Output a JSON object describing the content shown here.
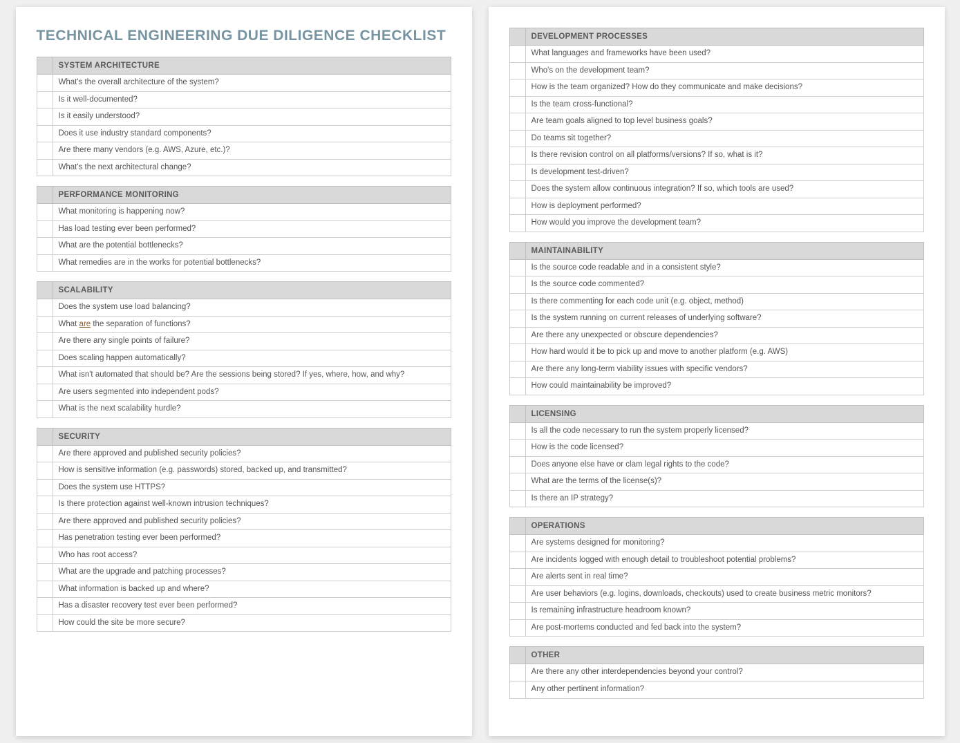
{
  "title": "TECHNICAL ENGINEERING DUE DILIGENCE CHECKLIST",
  "left_sections": [
    {
      "heading": "SYSTEM ARCHITECTURE",
      "items": [
        "What's the overall architecture of the system?",
        "Is it well-documented?",
        "Is it easily understood?",
        "Does it use industry standard components?",
        "Are there many vendors (e.g. AWS, Azure, etc.)?",
        "What's the next architectural change?"
      ]
    },
    {
      "heading": "PERFORMANCE MONITORING",
      "items": [
        "What monitoring is happening now?",
        "Has load testing ever been performed?",
        "What are the potential bottlenecks?",
        "What remedies are in the works for potential bottlenecks?"
      ]
    },
    {
      "heading": "SCALABILITY",
      "items": [
        "Does the system use load balancing?",
        "What <u>are</u> the separation of functions?",
        "Are there any single points of failure?",
        "Does scaling happen automatically?",
        "What isn't automated that should be? Are the sessions being stored? If yes, where, how, and why?",
        "Are users segmented into independent pods?",
        "What is the next scalability hurdle?"
      ]
    },
    {
      "heading": "SECURITY",
      "items": [
        "Are there approved and published security policies?",
        "How is sensitive information (e.g. passwords) stored, backed up, and transmitted?",
        "Does the system use HTTPS?",
        "Is there protection against well-known intrusion techniques?",
        "Are there approved and published security policies?",
        "Has penetration testing ever been performed?",
        "Who has root access?",
        "What are the upgrade and patching processes?",
        "What information is backed up and where?",
        "Has a disaster recovery test ever been performed?",
        "How could the site be more secure?"
      ]
    }
  ],
  "right_sections": [
    {
      "heading": "DEVELOPMENT PROCESSES",
      "items": [
        "What languages and frameworks have been used?",
        "Who's on the development team?",
        "How is the team organized? How do they communicate and make decisions?",
        "Is the team cross-functional?",
        "Are team goals aligned to top level business goals?",
        "Do teams sit together?",
        "Is there revision control on all platforms/versions? If so, what is it?",
        "Is development test-driven?",
        "Does the system allow continuous integration? If so, which tools are used?",
        "How is deployment performed?",
        "How would you improve the development team?"
      ]
    },
    {
      "heading": "MAINTAINABILITY",
      "items": [
        "Is the source code readable and in a consistent style?",
        "Is the source code commented?",
        "Is there commenting for each code unit (e.g. object, method)",
        "Is the system running on current releases of underlying software?",
        "Are there any unexpected or obscure dependencies?",
        "How hard would it be to pick up and move to another platform (e.g. AWS)",
        "Are there any long-term viability issues with specific vendors?",
        "How could maintainability be improved?"
      ]
    },
    {
      "heading": "LICENSING",
      "items": [
        "Is all the code necessary to run the system properly licensed?",
        "How is the code licensed?",
        "Does anyone else have or clam legal rights to the code?",
        "What are the terms of the license(s)?",
        "Is there an IP strategy?"
      ]
    },
    {
      "heading": "OPERATIONS",
      "items": [
        "Are systems designed for monitoring?",
        "Are incidents logged with enough detail to troubleshoot potential problems?",
        "Are alerts sent in real time?",
        "Are user behaviors (e.g. logins, downloads, checkouts) used to create business metric monitors?",
        "Is remaining infrastructure headroom known?",
        "Are post-mortems conducted and fed back into the system?"
      ]
    },
    {
      "heading": "OTHER",
      "items": [
        "Are there any other interdependencies beyond your control?",
        "Any other pertinent information?"
      ]
    }
  ]
}
